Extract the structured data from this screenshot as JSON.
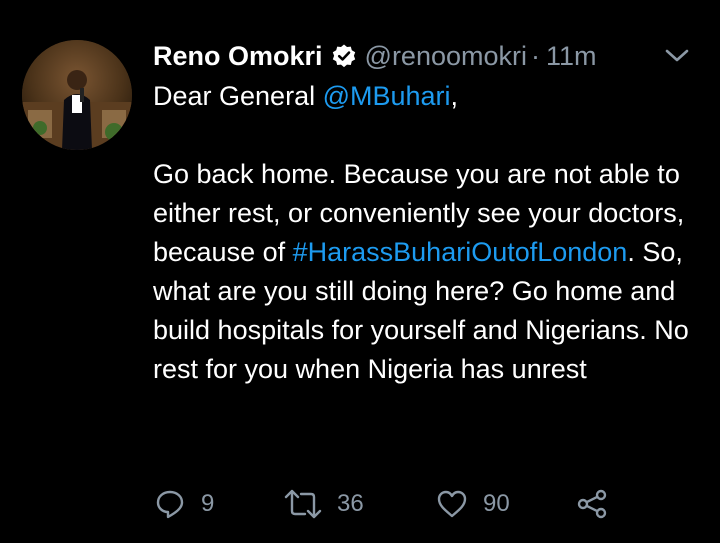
{
  "tweet": {
    "author_name": "Reno Omokri",
    "handle": "@renoomokri",
    "separator": "·",
    "time": "11m",
    "body": {
      "line1_prefix": "Dear General ",
      "line1_mention": "@MBuhari",
      "line1_suffix": ",",
      "p2_part1": "Go back home. Because you are not able to either rest, or conveniently see your doctors, because of ",
      "p2_hashtag": "#HarassBuhariOutofLondon",
      "p2_part2": ". So, what are you still doing here? Go home and build hospitals for yourself and Nigerians. No rest for you when Nigeria has unrest"
    },
    "actions": {
      "reply_count": "9",
      "retweet_count": "36",
      "like_count": "90"
    }
  },
  "icons": {
    "verified": "verified-badge-icon",
    "chevron": "chevron-down-icon",
    "reply": "reply-icon",
    "retweet": "retweet-icon",
    "like": "heart-icon",
    "share": "share-icon"
  },
  "colors": {
    "background": "#000000",
    "link": "#1d9bf0",
    "muted": "#8b98a5",
    "text": "#ffffff"
  }
}
